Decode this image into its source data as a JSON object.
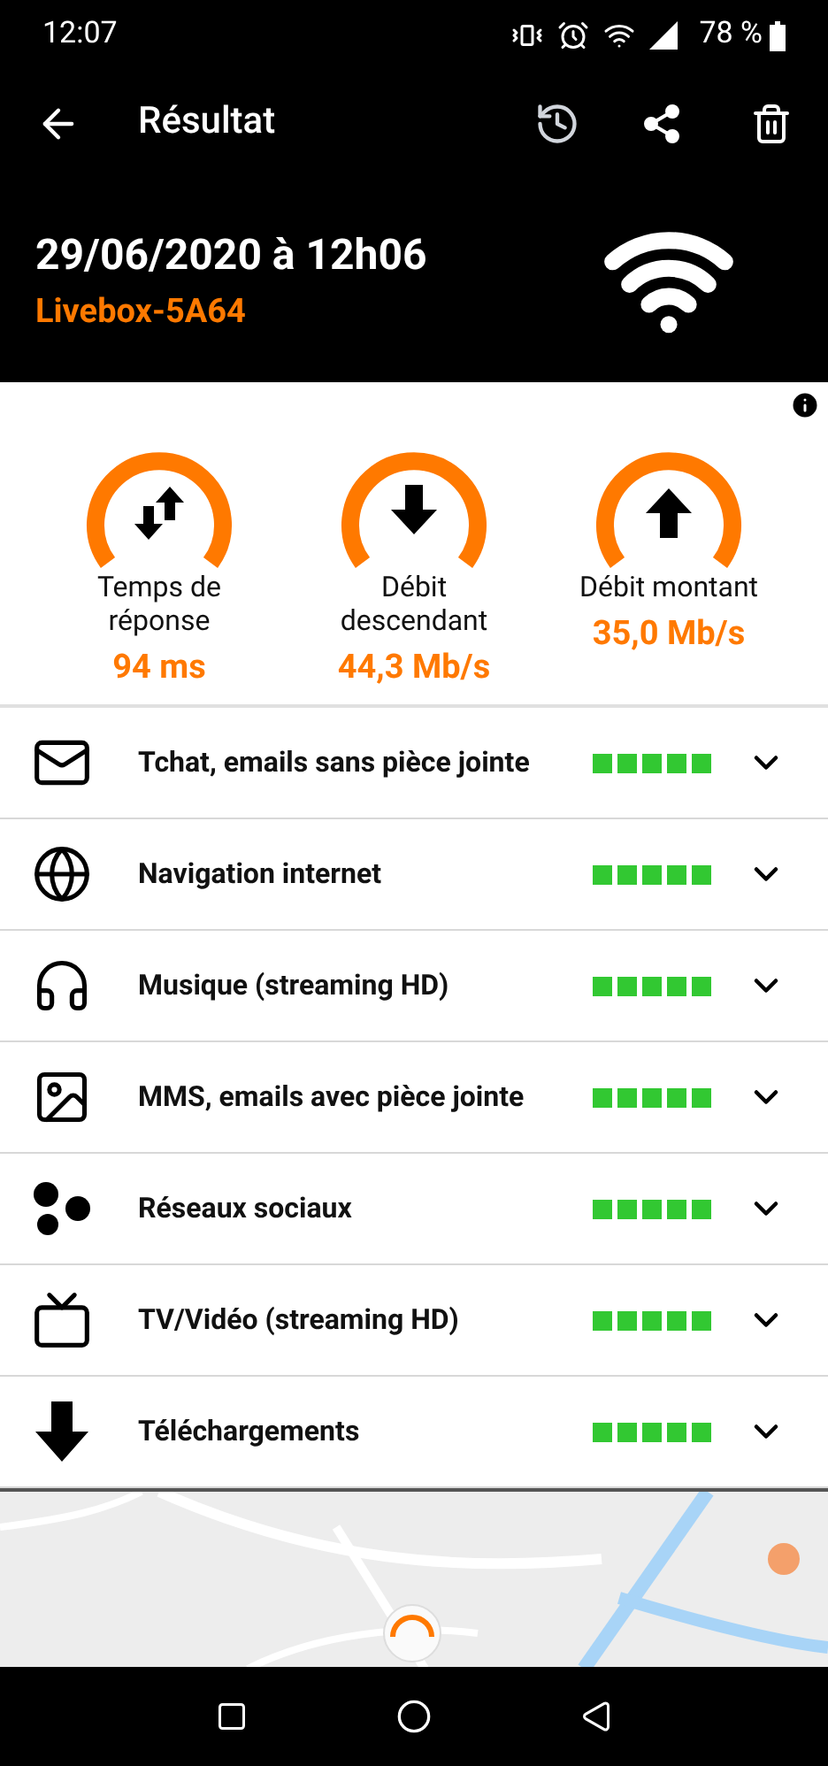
{
  "status_bar": {
    "time": "12:07",
    "battery": "78 %"
  },
  "app_bar": {
    "title": "Résultat"
  },
  "header": {
    "date": "29/06/2020 à 12h06",
    "network": "Livebox-5A64"
  },
  "gauges": [
    {
      "label": "Temps de réponse",
      "value": "94 ms"
    },
    {
      "label": "Débit descendant",
      "value": "44,3 Mb/s"
    },
    {
      "label": "Débit montant",
      "value": "35,0 Mb/s"
    }
  ],
  "usages": [
    {
      "label": "Tchat, emails sans pièce jointe",
      "stars": 5
    },
    {
      "label": "Navigation internet",
      "stars": 5
    },
    {
      "label": "Musique (streaming HD)",
      "stars": 5
    },
    {
      "label": "MMS, emails avec pièce jointe",
      "stars": 5
    },
    {
      "label": "Réseaux sociaux",
      "stars": 5
    },
    {
      "label": "TV/Vidéo (streaming HD)",
      "stars": 5
    },
    {
      "label": "Téléchargements",
      "stars": 5
    }
  ]
}
